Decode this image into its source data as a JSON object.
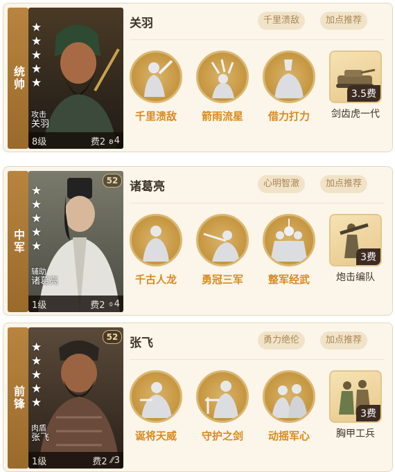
{
  "cards": [
    {
      "role": "统帅",
      "portrait": {
        "stars": 5,
        "type_label": "攻击",
        "name": "关羽",
        "level": "8级",
        "cost": "费2",
        "troop_count": "4",
        "troop_icon": "wing-icon",
        "badge": ""
      },
      "general_name": "关羽",
      "tags": [
        "千里溃敌",
        "加点推荐"
      ],
      "skills": [
        "千里溃敌",
        "箭雨流星",
        "借力打力"
      ],
      "unit": {
        "name": "剑齿虎一代",
        "fee": "3.5费",
        "icon": "tank-icon"
      }
    },
    {
      "role": "中军",
      "portrait": {
        "stars": 5,
        "type_label": "辅助",
        "name": "诸葛亮",
        "level": "1级",
        "cost": "费2",
        "troop_count": "4",
        "troop_icon": "sword-icon",
        "badge": "52"
      },
      "general_name": "诸葛亮",
      "tags": [
        "心明智澈",
        "加点推荐"
      ],
      "skills": [
        "千古人龙",
        "勇冠三军",
        "整军经武"
      ],
      "unit": {
        "name": "炮击编队",
        "fee": "3费",
        "icon": "bazooka-soldier-icon"
      }
    },
    {
      "role": "前锋",
      "portrait": {
        "stars": 5,
        "type_label": "肉盾",
        "name": "张飞",
        "level": "1级",
        "cost": "费2",
        "troop_count": "3",
        "troop_icon": "feather-icon",
        "badge": "52"
      },
      "general_name": "张飞",
      "tags": [
        "勇力绝伦",
        "加点推荐"
      ],
      "skills": [
        "诞将天威",
        "守护之剑",
        "动摇军心"
      ],
      "unit": {
        "name": "胸甲工兵",
        "fee": "3费",
        "icon": "armored-soldier-icon"
      }
    }
  ],
  "colors": {
    "accent": "#d88a1e",
    "role_bar": "#a8732f",
    "card_bg": "#fbf5ea",
    "tag_bg": "#f1e3c8"
  }
}
